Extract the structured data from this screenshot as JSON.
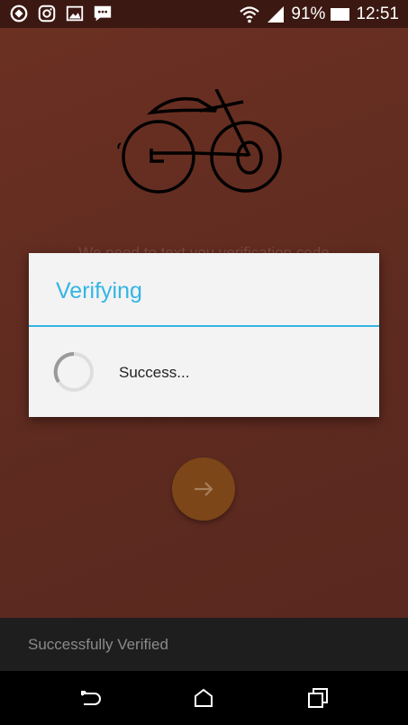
{
  "status_bar": {
    "left_icons": [
      "sync-icon",
      "instagram-icon",
      "image-icon",
      "message-icon"
    ],
    "battery_percent": "91%",
    "time": "12:51"
  },
  "background": {
    "obscured_text": "We need to text you verification code"
  },
  "dialog": {
    "title": "Verifying",
    "message": "Success..."
  },
  "snackbar": {
    "message": "Successfully Verified"
  },
  "nav_bar": {
    "buttons": [
      "back-icon",
      "home-icon",
      "recents-icon"
    ]
  },
  "colors": {
    "accent": "#33b5e5",
    "app_background": "#5f2b20",
    "fab": "#7c4618"
  }
}
